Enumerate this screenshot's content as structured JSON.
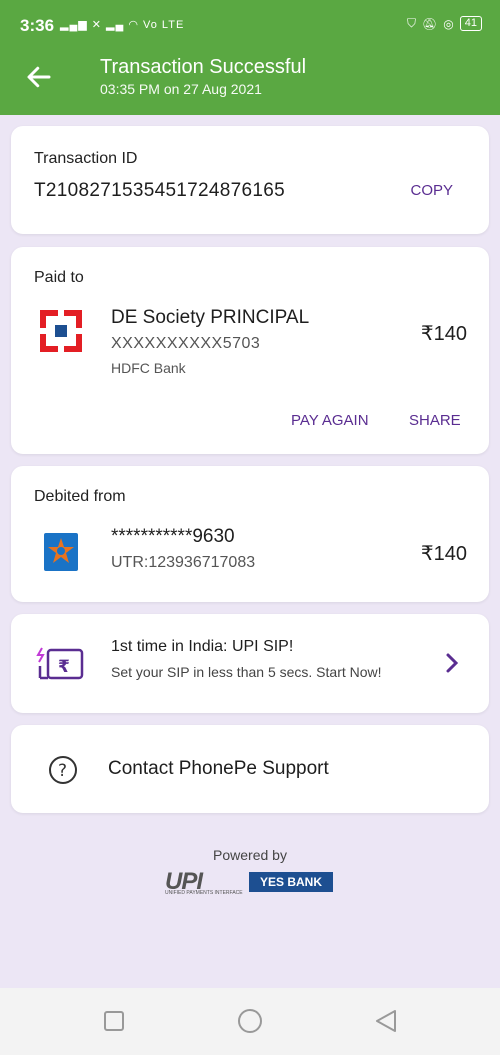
{
  "status_bar": {
    "time": "3:36",
    "signal": "Vo LTE",
    "battery": "41",
    "icons": [
      "signal-icon",
      "wifi-icon",
      "shield-icon",
      "mute-icon",
      "alarm-icon",
      "battery-icon"
    ]
  },
  "header": {
    "title": "Transaction Successful",
    "subtitle": "03:35 PM on 27 Aug 2021",
    "bg_color": "#5aa842"
  },
  "transaction": {
    "label": "Transaction ID",
    "id": "T2108271535451724876165",
    "copy_label": "COPY"
  },
  "paid_to": {
    "label": "Paid to",
    "name": "DE Society PRINCIPAL",
    "account": "XXXXXXXXXX5703",
    "bank": "HDFC Bank",
    "amount": "₹140",
    "pay_again_label": "PAY AGAIN",
    "share_label": "SHARE"
  },
  "debited_from": {
    "label": "Debited from",
    "account": "***********9630",
    "utr": "UTR:123936717083",
    "amount": "₹140"
  },
  "promo": {
    "title": "1st time in India: UPI SIP!",
    "subtitle": "Set your SIP in less than 5 secs. Start Now!"
  },
  "support": {
    "label": "Contact PhonePe Support"
  },
  "footer": {
    "powered_by": "Powered by",
    "upi_logo_text": "UPI",
    "upi_sub_text": "UNIFIED PAYMENTS INTERFACE",
    "bank_logo_text": "YES BANK"
  },
  "colors": {
    "accent": "#5a2d91",
    "background": "#ece6f5"
  }
}
